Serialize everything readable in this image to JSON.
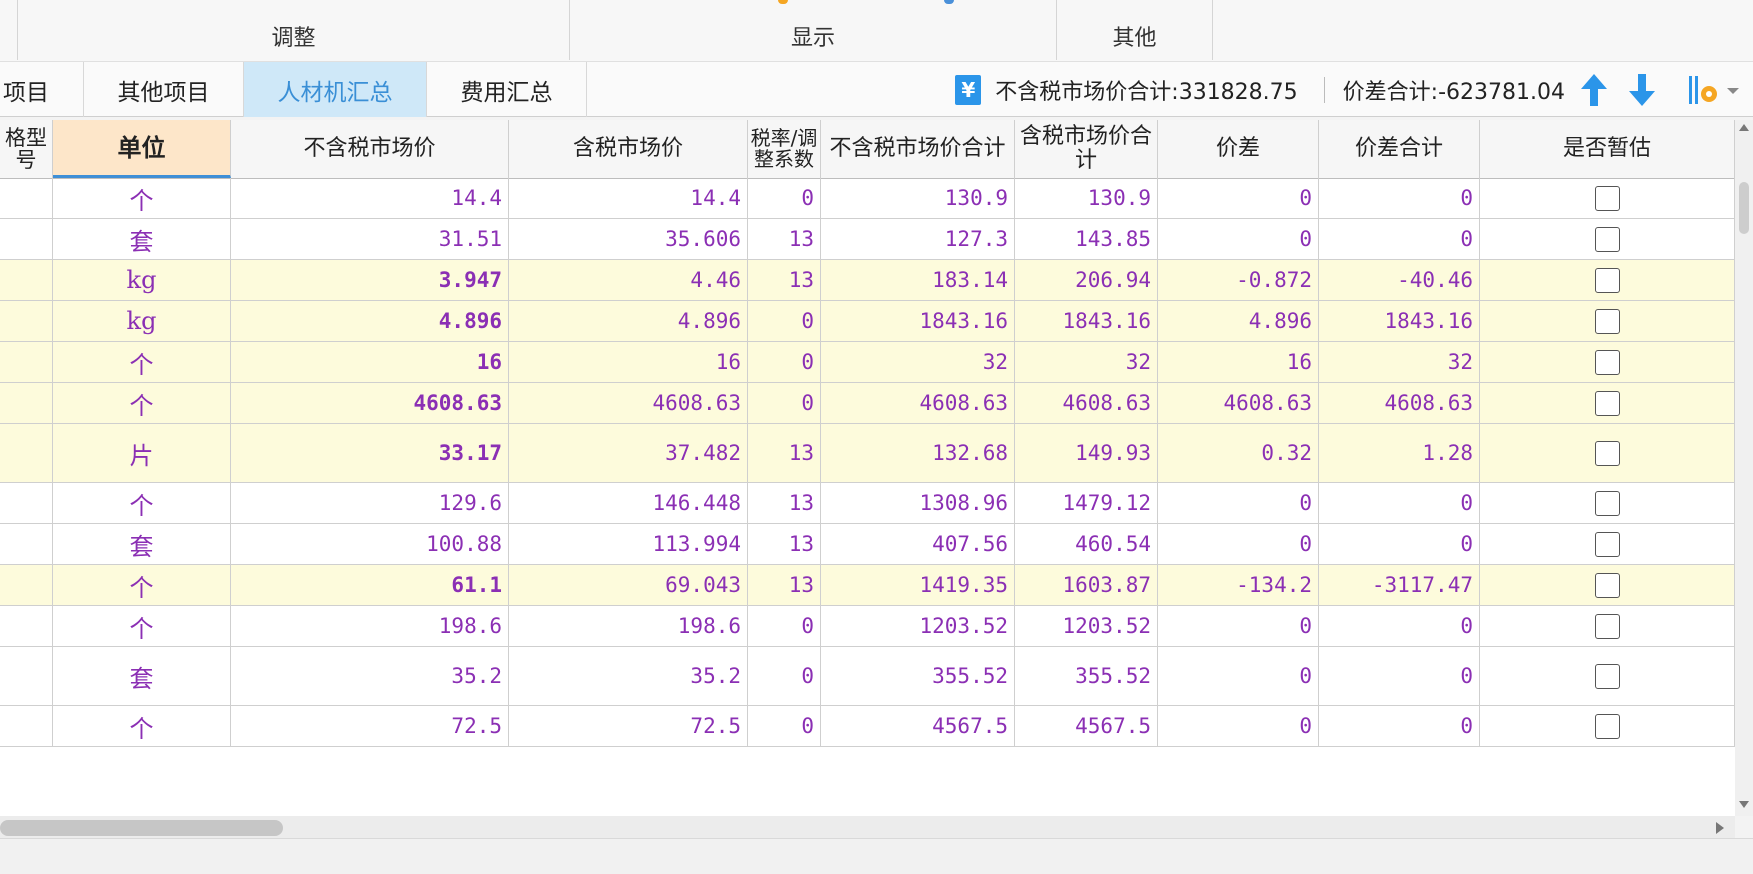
{
  "ribbon": {
    "groups": [
      "调整",
      "显示",
      "其他"
    ]
  },
  "tabs": [
    {
      "label": "项目",
      "active": false
    },
    {
      "label": "其他项目",
      "active": false
    },
    {
      "label": "人材机汇总",
      "active": true
    },
    {
      "label": "费用汇总",
      "active": false
    }
  ],
  "summary": {
    "yen_icon": "¥",
    "market_total_label": "不含税市场价合计:331828.75",
    "diff_total_label": "价差合计:-623781.04"
  },
  "columns": [
    "格型号",
    "单位",
    "不含税市场价",
    "含税市场价",
    "税率/调整系数",
    "不含税市场价合计",
    "含税市场价合计",
    "价差",
    "价差合计",
    "是否暂估"
  ],
  "rows": [
    {
      "unit": "个",
      "price_ex": "14.4",
      "price_inc": "14.4",
      "tax": "0",
      "total_ex": "130.9",
      "total_inc": "130.9",
      "diff": "0",
      "diff_total": "0",
      "highlight": false,
      "bold": false
    },
    {
      "unit": "套",
      "price_ex": "31.51",
      "price_inc": "35.606",
      "tax": "13",
      "total_ex": "127.3",
      "total_inc": "143.85",
      "diff": "0",
      "diff_total": "0",
      "highlight": false,
      "bold": false
    },
    {
      "unit": "kg",
      "price_ex": "3.947",
      "price_inc": "4.46",
      "tax": "13",
      "total_ex": "183.14",
      "total_inc": "206.94",
      "diff": "-0.872",
      "diff_total": "-40.46",
      "highlight": true,
      "bold": true
    },
    {
      "unit": "kg",
      "price_ex": "4.896",
      "price_inc": "4.896",
      "tax": "0",
      "total_ex": "1843.16",
      "total_inc": "1843.16",
      "diff": "4.896",
      "diff_total": "1843.16",
      "highlight": true,
      "bold": true
    },
    {
      "unit": "个",
      "price_ex": "16",
      "price_inc": "16",
      "tax": "0",
      "total_ex": "32",
      "total_inc": "32",
      "diff": "16",
      "diff_total": "32",
      "highlight": true,
      "bold": true
    },
    {
      "unit": "个",
      "price_ex": "4608.63",
      "price_inc": "4608.63",
      "tax": "0",
      "total_ex": "4608.63",
      "total_inc": "4608.63",
      "diff": "4608.63",
      "diff_total": "4608.63",
      "highlight": true,
      "bold": true
    },
    {
      "unit": "片",
      "price_ex": "33.17",
      "price_inc": "37.482",
      "tax": "13",
      "total_ex": "132.68",
      "total_inc": "149.93",
      "diff": "0.32",
      "diff_total": "1.28",
      "highlight": true,
      "bold": true
    },
    {
      "unit": "个",
      "price_ex": "129.6",
      "price_inc": "146.448",
      "tax": "13",
      "total_ex": "1308.96",
      "total_inc": "1479.12",
      "diff": "0",
      "diff_total": "0",
      "highlight": false,
      "bold": false
    },
    {
      "unit": "套",
      "price_ex": "100.88",
      "price_inc": "113.994",
      "tax": "13",
      "total_ex": "407.56",
      "total_inc": "460.54",
      "diff": "0",
      "diff_total": "0",
      "highlight": false,
      "bold": false
    },
    {
      "unit": "个",
      "price_ex": "61.1",
      "price_inc": "69.043",
      "tax": "13",
      "total_ex": "1419.35",
      "total_inc": "1603.87",
      "diff": "-134.2",
      "diff_total": "-3117.47",
      "highlight": true,
      "bold": true
    },
    {
      "unit": "个",
      "price_ex": "198.6",
      "price_inc": "198.6",
      "tax": "0",
      "total_ex": "1203.52",
      "total_inc": "1203.52",
      "diff": "0",
      "diff_total": "0",
      "highlight": false,
      "bold": false
    },
    {
      "unit": "套",
      "price_ex": "35.2",
      "price_inc": "35.2",
      "tax": "0",
      "total_ex": "355.52",
      "total_inc": "355.52",
      "diff": "0",
      "diff_total": "0",
      "highlight": false,
      "bold": false
    },
    {
      "unit": "个",
      "price_ex": "72.5",
      "price_inc": "72.5",
      "tax": "0",
      "total_ex": "4567.5",
      "total_inc": "4567.5",
      "diff": "0",
      "diff_total": "0",
      "highlight": false,
      "bold": false
    }
  ],
  "colors": {
    "value_text": "#8b2fb4",
    "highlight_row": "#fdfbdc",
    "active_tab": "#cfe8f8",
    "unit_header": "#fde6c9",
    "arrow": "#2b95e9"
  },
  "icons": [
    "yen-icon",
    "arrow-up-icon",
    "arrow-down-icon",
    "settings-icon",
    "dropdown-caret-icon",
    "checkbox"
  ]
}
